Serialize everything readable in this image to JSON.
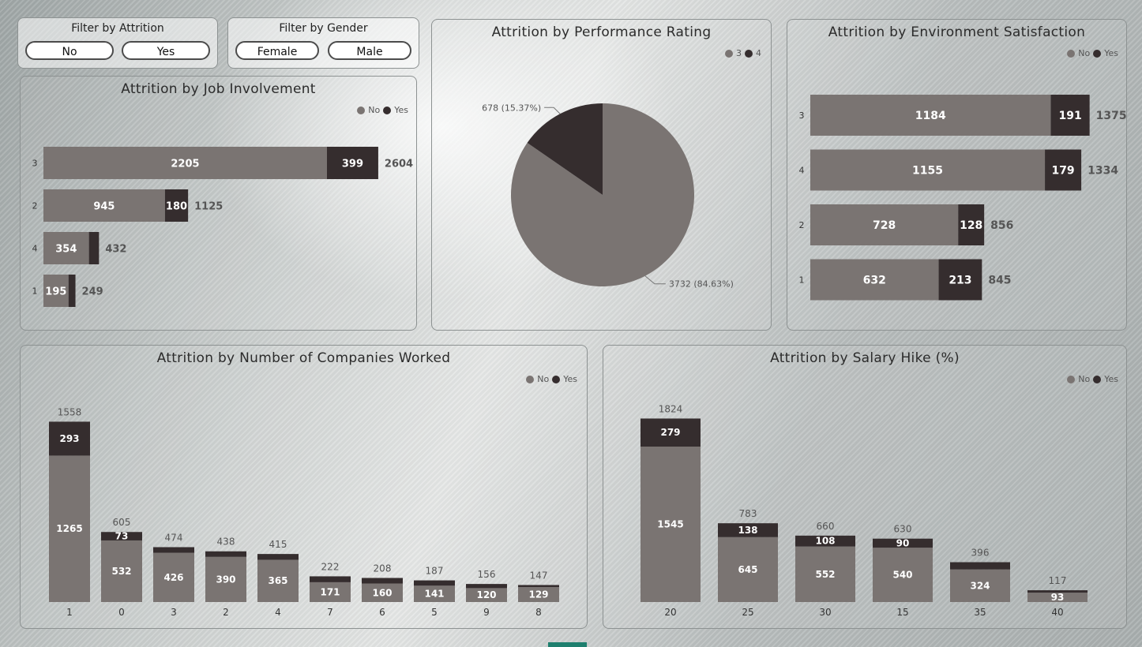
{
  "colors": {
    "no": "#7a7472",
    "yes": "#352d2e",
    "label_in": "#ffffff",
    "label_out": "#555555"
  },
  "filters": {
    "attrition": {
      "title": "Filter by Attrition",
      "options": [
        "No",
        "Yes"
      ]
    },
    "gender": {
      "title": "Filter by Gender",
      "options": [
        "Female",
        "Male"
      ]
    }
  },
  "legend_no_yes": [
    "No",
    "Yes"
  ],
  "legend_perf": [
    "3",
    "4"
  ],
  "charts": {
    "job_involvement": {
      "title": "Attrition by Job Involvement"
    },
    "performance": {
      "title": "Attrition by Performance Rating"
    },
    "environment": {
      "title": "Attrition by Environment Satisfaction"
    },
    "companies": {
      "title": "Attrition by Number of Companies Worked"
    },
    "salary": {
      "title": "Attrition by Salary Hike (%)"
    }
  },
  "chart_data": [
    {
      "type": "bar",
      "orientation": "horizontal",
      "stacked": true,
      "title": "Attrition by Job Involvement",
      "categories": [
        "3",
        "2",
        "4",
        "1"
      ],
      "series": [
        {
          "name": "No",
          "values": [
            2205,
            945,
            354,
            195
          ]
        },
        {
          "name": "Yes",
          "values": [
            399,
            180,
            78,
            54
          ]
        }
      ],
      "totals": [
        "2604",
        "1125",
        "432",
        "249"
      ],
      "legend": "top-right"
    },
    {
      "type": "pie",
      "title": "Attrition by Performance Rating",
      "slices": [
        {
          "name": "3",
          "value": 3732,
          "label": "3732 (84.63%)"
        },
        {
          "name": "4",
          "value": 678,
          "label": "678 (15.37%)"
        }
      ],
      "legend": "top-right"
    },
    {
      "type": "bar",
      "orientation": "horizontal",
      "stacked": true,
      "title": "Attrition by Environment Satisfaction",
      "categories": [
        "3",
        "4",
        "2",
        "1"
      ],
      "series": [
        {
          "name": "No",
          "values": [
            1184,
            1155,
            728,
            632
          ]
        },
        {
          "name": "Yes",
          "values": [
            191,
            179,
            128,
            213
          ]
        }
      ],
      "totals": [
        "1375",
        "1334",
        "856",
        "845"
      ],
      "legend": "top-right"
    },
    {
      "type": "bar",
      "orientation": "vertical",
      "stacked": true,
      "title": "Attrition by Number of Companies Worked",
      "categories": [
        "1",
        "0",
        "3",
        "2",
        "4",
        "7",
        "6",
        "5",
        "9",
        "8"
      ],
      "series": [
        {
          "name": "No",
          "values": [
            1265,
            532,
            426,
            390,
            365,
            171,
            160,
            141,
            120,
            129
          ]
        },
        {
          "name": "Yes",
          "values": [
            293,
            73,
            48,
            48,
            50,
            51,
            48,
            46,
            36,
            18
          ]
        }
      ],
      "totals": [
        "1558",
        "605",
        "474",
        "438",
        "415",
        "222",
        "208",
        "187",
        "156",
        "147"
      ],
      "yes_labels": [
        "293",
        "73",
        "",
        "",
        "",
        "",
        "",
        "",
        "",
        ""
      ],
      "legend": "top-right"
    },
    {
      "type": "bar",
      "orientation": "vertical",
      "stacked": true,
      "title": "Attrition by Salary Hike (%)",
      "categories": [
        "20",
        "25",
        "30",
        "15",
        "35",
        "40"
      ],
      "series": [
        {
          "name": "No",
          "values": [
            1545,
            645,
            552,
            540,
            324,
            93
          ]
        },
        {
          "name": "Yes",
          "values": [
            279,
            138,
            108,
            90,
            72,
            24
          ]
        }
      ],
      "totals": [
        "1824",
        "783",
        "660",
        "630",
        "396",
        "117"
      ],
      "yes_labels": [
        "279",
        "138",
        "108",
        "90",
        "",
        ""
      ],
      "legend": "top-right"
    }
  ]
}
